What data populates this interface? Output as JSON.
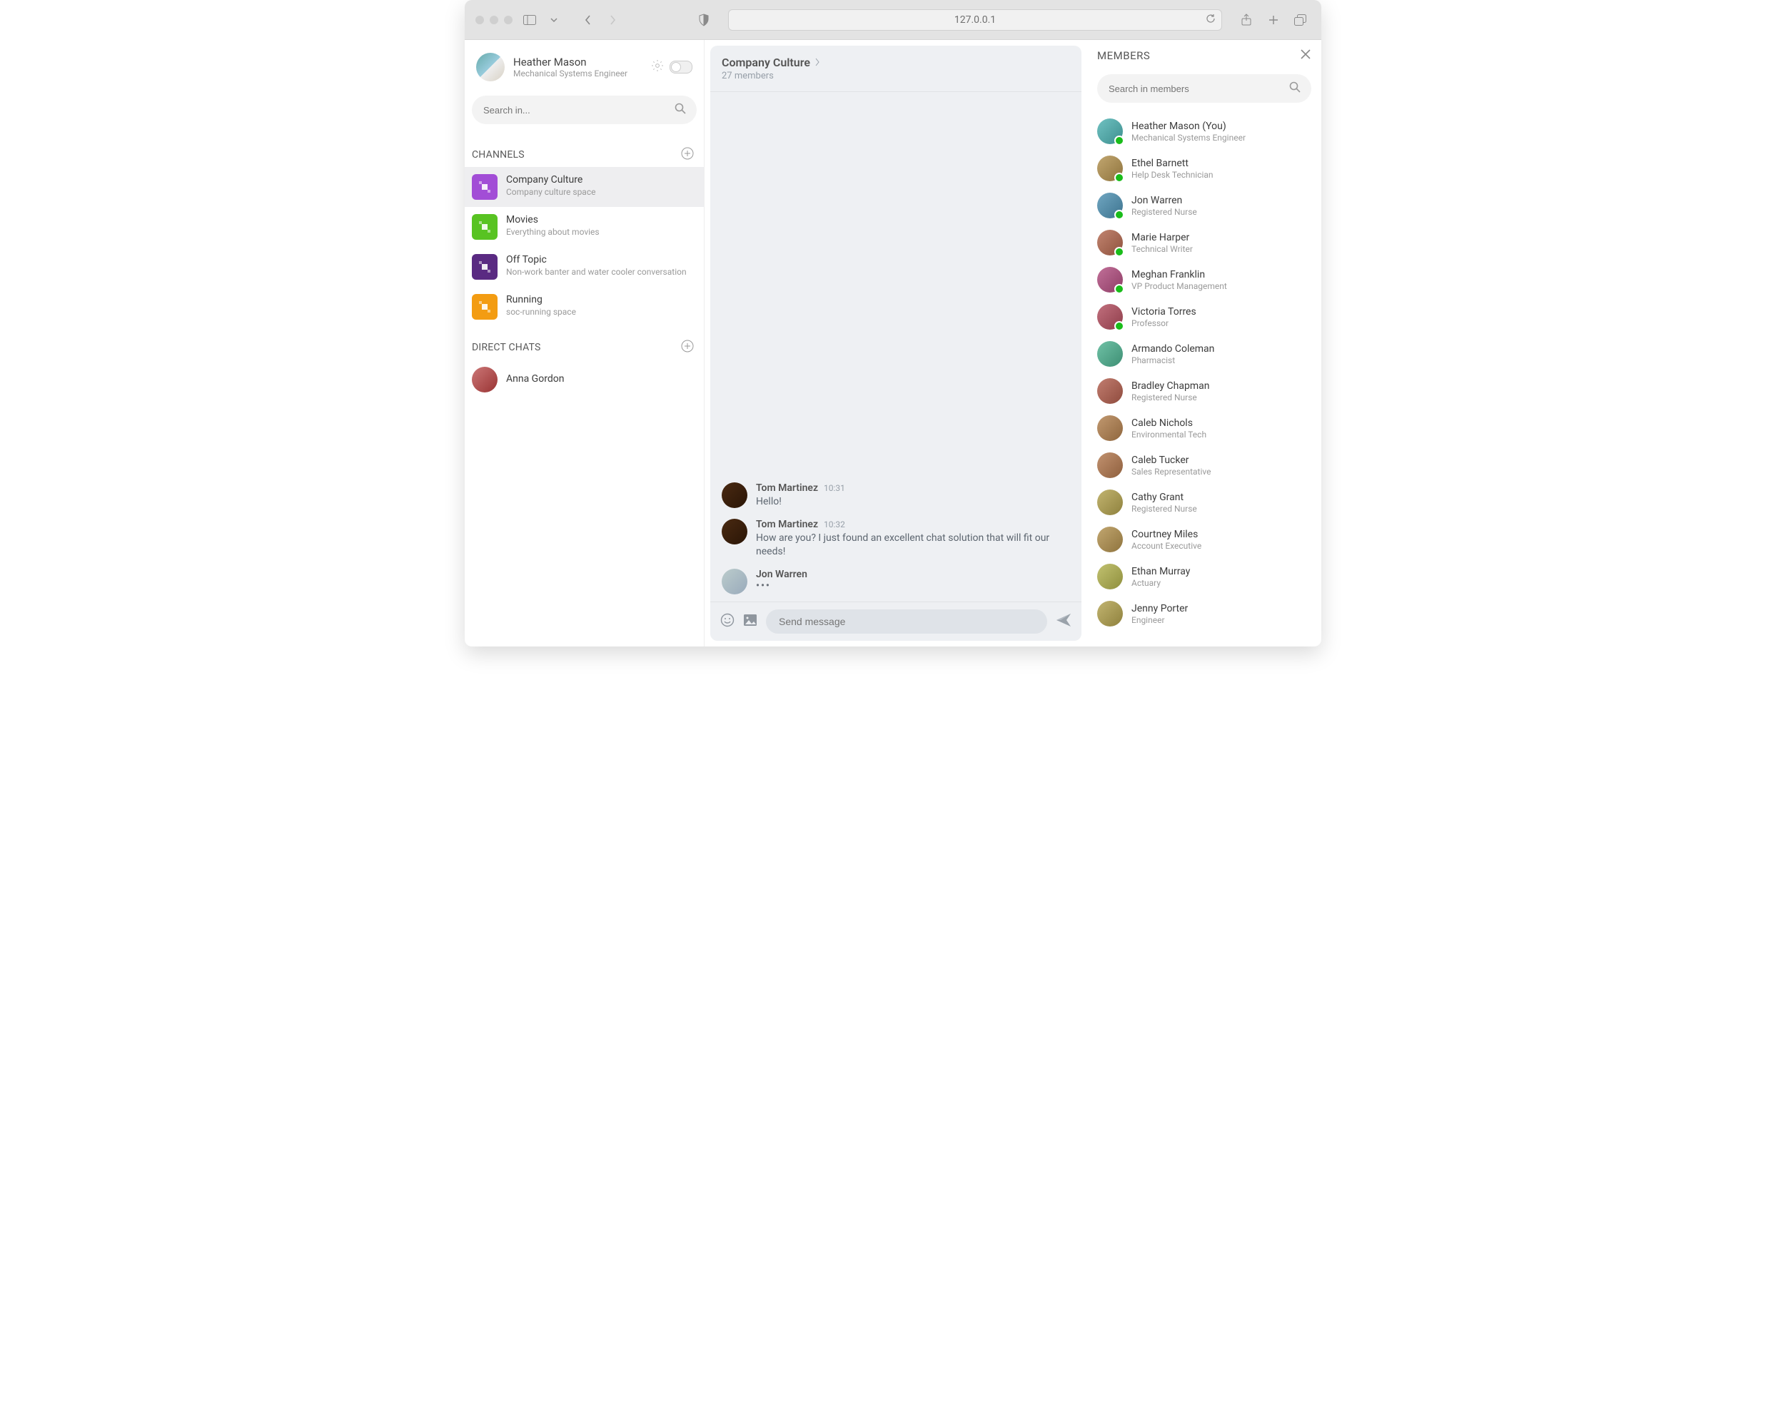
{
  "browser": {
    "url": "127.0.0.1"
  },
  "user": {
    "name": "Heather Mason",
    "role": "Mechanical Systems Engineer"
  },
  "sidebar": {
    "search_placeholder": "Search in...",
    "channels_label": "CHANNELS",
    "direct_label": "DIRECT CHATS",
    "channels": [
      {
        "title": "Company Culture",
        "sub": "Company culture space",
        "color": "#a24dd6",
        "active": true
      },
      {
        "title": "Movies",
        "sub": "Everything about movies",
        "color": "#58c322"
      },
      {
        "title": "Off Topic",
        "sub": "Non-work banter and water cooler conversation",
        "color": "#5a2a82"
      },
      {
        "title": "Running",
        "sub": "soc-running space",
        "color": "#f39c12"
      }
    ],
    "dms": [
      {
        "name": "Anna Gordon"
      }
    ]
  },
  "chat": {
    "title": "Company Culture",
    "members_sub": "27 members",
    "messages": [
      {
        "author": "Tom Martinez",
        "time": "10:31",
        "text": "Hello!",
        "typing": false
      },
      {
        "author": "Tom Martinez",
        "time": "10:32",
        "text": "How are you? I just found an excellent chat solution that will fit our needs!",
        "typing": false
      },
      {
        "author": "Jon Warren",
        "time": "",
        "text": "",
        "typing": true
      }
    ],
    "composer_placeholder": "Send message"
  },
  "members_panel": {
    "title": "MEMBERS",
    "search_placeholder": "Search in members",
    "list": [
      {
        "name": "Heather Mason (You)",
        "role": "Mechanical Systems Engineer",
        "online": true
      },
      {
        "name": "Ethel Barnett",
        "role": "Help Desk Technician",
        "online": true
      },
      {
        "name": "Jon Warren",
        "role": "Registered Nurse",
        "online": true
      },
      {
        "name": "Marie Harper",
        "role": "Technical Writer",
        "online": true
      },
      {
        "name": "Meghan Franklin",
        "role": "VP Product Management",
        "online": true
      },
      {
        "name": "Victoria Torres",
        "role": "Professor",
        "online": true
      },
      {
        "name": "Armando Coleman",
        "role": "Pharmacist",
        "online": false
      },
      {
        "name": "Bradley Chapman",
        "role": "Registered Nurse",
        "online": false
      },
      {
        "name": "Caleb Nichols",
        "role": "Environmental Tech",
        "online": false
      },
      {
        "name": "Caleb Tucker",
        "role": "Sales Representative",
        "online": false
      },
      {
        "name": "Cathy Grant",
        "role": "Registered Nurse",
        "online": false
      },
      {
        "name": "Courtney Miles",
        "role": "Account Executive",
        "online": false
      },
      {
        "name": "Ethan Murray",
        "role": "Actuary",
        "online": false
      },
      {
        "name": "Jenny Porter",
        "role": "Engineer",
        "online": false
      }
    ]
  }
}
